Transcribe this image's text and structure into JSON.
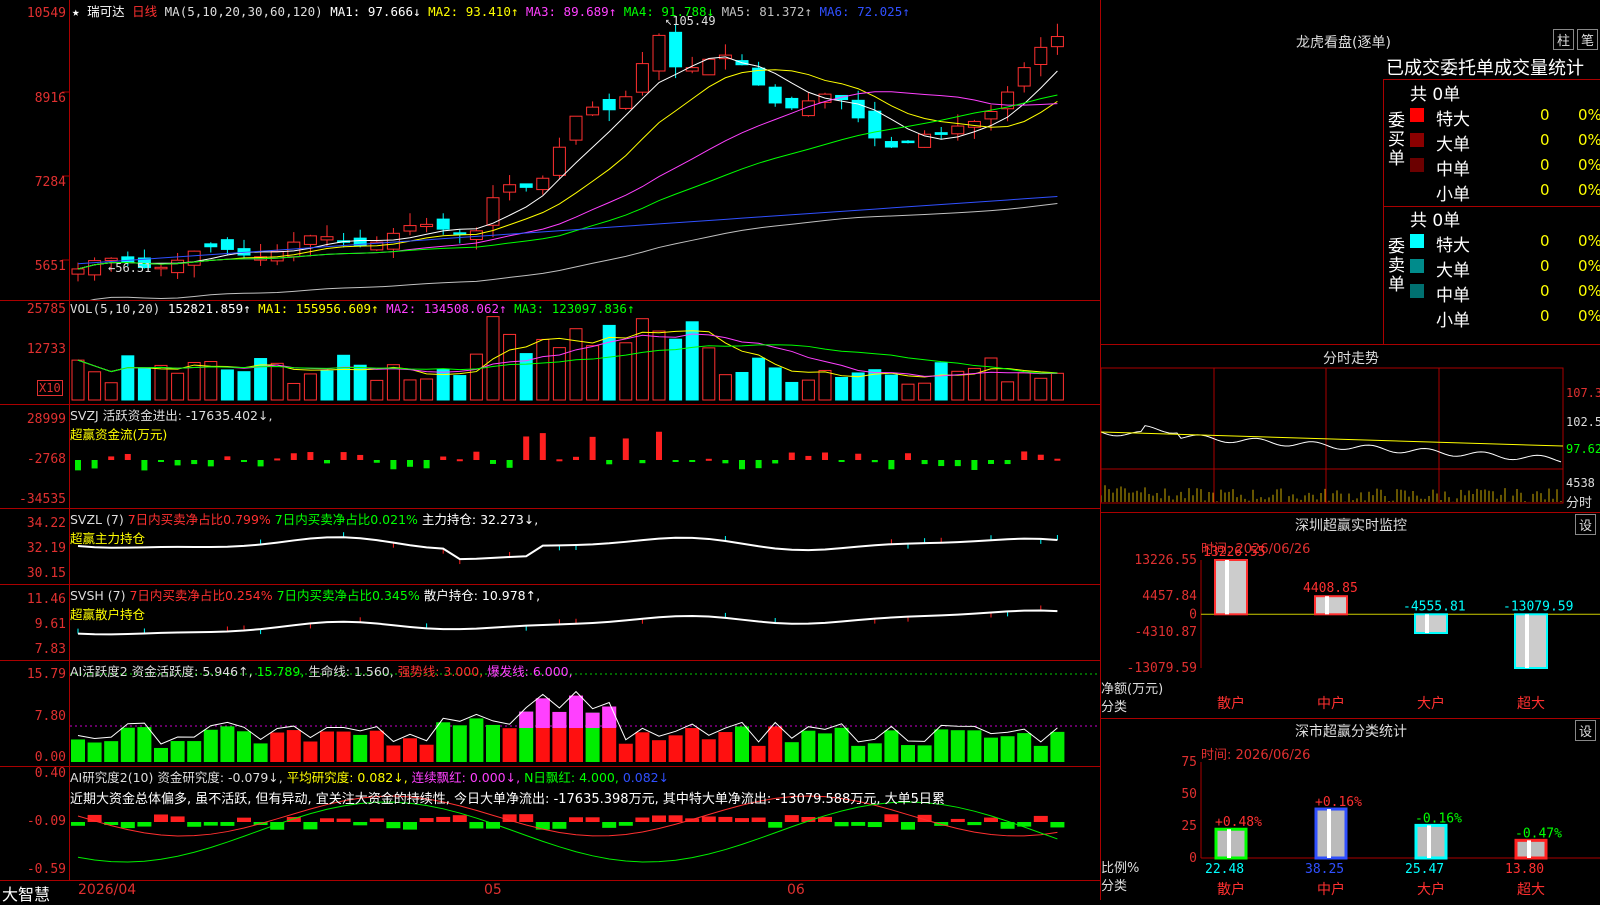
{
  "stock": {
    "star": "★",
    "name": "瑞可达",
    "period": "日线"
  },
  "kline": {
    "ma_label": "MA(5,10,20,30,60,120)",
    "ma1": "MA1: 97.666↓",
    "ma2": "MA2: 93.410↑",
    "ma3": "MA3: 89.689↑",
    "ma4": "MA4: 91.788↓",
    "ma5": "MA5: 81.372↑",
    "ma6": "MA6: 72.025↑",
    "y_ticks": [
      "10549",
      "8916",
      "7284",
      "5651"
    ],
    "high_label": "105.49",
    "low_label": "56.51"
  },
  "vol": {
    "label": "VOL(5,10,20)",
    "value": "152821.859↑",
    "ma1": "MA1: 155956.609↑",
    "ma2": "MA2: 134508.062↑",
    "ma3": "MA3: 123097.836↑",
    "y_ticks": [
      "25785",
      "12733"
    ],
    "unit": "X10"
  },
  "svzj": {
    "label": "SVZJ  活跃资金进出: -17635.402↓,",
    "sub": "超赢资金流(万元)",
    "y_ticks": [
      "28999",
      "-2768",
      "-34535"
    ]
  },
  "svzl": {
    "label": "SVZL  (7)",
    "a": "7日内买卖净占比0.799%",
    "b": "7日内买卖净占比0.021%",
    "c": "主力持仓: 32.273↓,",
    "sub": "超赢主力持仓",
    "y_ticks": [
      "34.22",
      "32.19",
      "30.15"
    ]
  },
  "svsh": {
    "label": "SVSH  (7)",
    "a": "7日内买卖净占比0.254%",
    "b": "7日内买卖净占比0.345%",
    "c": "散户持仓: 10.978↑,",
    "sub": "超赢散户持仓",
    "y_ticks": [
      "11.46",
      "9.61",
      "7.83"
    ]
  },
  "ai1": {
    "label": "AI活跃度2 资金活跃度: 5.946↑,",
    "b": "15.789,",
    "c": "生命线: 1.560,",
    "d": "强势线: 3.000,",
    "e": "爆发线: 6.000,",
    "y_ticks": [
      "15.79",
      "7.80",
      "0.00"
    ]
  },
  "ai2": {
    "label": "AI研究度2(10) 资金研究度: -0.079↓,",
    "b": "平均研究度: 0.082↓,",
    "c": "连续飘红: 0.000↓,",
    "d": "N日飘红: 4.000,",
    "e": "0.082↓",
    "text": "近期大资金总体偏多, 虽不活跃, 但有异动, 宜关注大资金的持续性, 今日大单净流出: -17635.398万元, 其中特大单净流出: -13079.588万元, 大单5日累",
    "y_ticks": [
      "0.40",
      "-0.09",
      "-0.59"
    ]
  },
  "footer": {
    "brand": "大智慧",
    "d1": "2026/04",
    "d2": "05",
    "d3": "06"
  },
  "lhb": {
    "title": "龙虎看盘(逐单)",
    "btn1": "柱",
    "btn2": "笔",
    "header": "已成交委托单成交量统计",
    "buy_label": "委买单",
    "sell_label": "委卖单",
    "total_buy": "共 0单",
    "total_sell": "共 0单",
    "buy_rows": [
      {
        "name": "特大",
        "v": "0",
        "p": "0%"
      },
      {
        "name": "大单",
        "v": "0",
        "p": "0%"
      },
      {
        "name": "中单",
        "v": "0",
        "p": "0%"
      },
      {
        "name": "小单",
        "v": "0",
        "p": "0%"
      }
    ],
    "sell_rows": [
      {
        "name": "特大",
        "v": "0",
        "p": "0%"
      },
      {
        "name": "大单",
        "v": "0",
        "p": "0%"
      },
      {
        "name": "中单",
        "v": "0",
        "p": "0%"
      },
      {
        "name": "小单",
        "v": "0",
        "p": "0%"
      }
    ],
    "colors": {
      "buy": [
        "#ff0000",
        "#8b0000",
        "#6b0000",
        "#000000"
      ],
      "sell": [
        "#00ffff",
        "#008b8b",
        "#007070",
        "#000000"
      ]
    }
  },
  "fenshi": {
    "title": "分时走势",
    "y_ticks": [
      "107.3",
      "102.5",
      "97.62",
      "4538"
    ],
    "unit": "分时"
  },
  "monitor": {
    "title": "深圳超赢实时监控",
    "btn": "设",
    "time": "时间: 2026/06/26",
    "y_ticks": [
      "13226.55",
      "4457.84",
      "0",
      "-4310.87",
      "-13079.59"
    ],
    "axis_label": "净额(万元)",
    "cat_label": "分类",
    "bars": [
      {
        "name": "散户",
        "value": 13226.55,
        "label": "13226.55"
      },
      {
        "name": "中户",
        "value": 4408.85,
        "label": "4408.85"
      },
      {
        "name": "大户",
        "value": -4555.81,
        "label": "-4555.81"
      },
      {
        "name": "超大",
        "value": -13079.59,
        "label": "-13079.59"
      }
    ]
  },
  "classify": {
    "title": "深市超赢分类统计",
    "btn": "设",
    "time": "时间: 2026/06/26",
    "y_ticks": [
      "75",
      "50",
      "25",
      "0"
    ],
    "axis_label": "比例%",
    "cat_label": "分类",
    "bars": [
      {
        "name": "散户",
        "value": 22.48,
        "label": "22.48",
        "chg": "+0.48%",
        "color": "#00ff00"
      },
      {
        "name": "中户",
        "value": 38.25,
        "label": "38.25",
        "chg": "+0.16%",
        "color": "#3050ff"
      },
      {
        "name": "大户",
        "value": 25.47,
        "label": "25.47",
        "chg": "-0.16%",
        "color": "#00ffff"
      },
      {
        "name": "超大",
        "value": 13.8,
        "label": "13.80",
        "chg": "-0.47%",
        "color": "#ff2020"
      }
    ]
  },
  "chart_data": [
    {
      "type": "bar",
      "title": "深圳超赢实时监控",
      "ylabel": "净额(万元)",
      "categories": [
        "散户",
        "中户",
        "大户",
        "超大"
      ],
      "values": [
        13226.55,
        4408.85,
        -4555.81,
        -13079.59
      ],
      "ylim": [
        -13079.59,
        13226.55
      ]
    },
    {
      "type": "bar",
      "title": "深市超赢分类统计",
      "ylabel": "比例%",
      "categories": [
        "散户",
        "中户",
        "大户",
        "超大"
      ],
      "values": [
        22.48,
        38.25,
        25.47,
        13.8
      ],
      "ylim": [
        0,
        75
      ]
    }
  ]
}
